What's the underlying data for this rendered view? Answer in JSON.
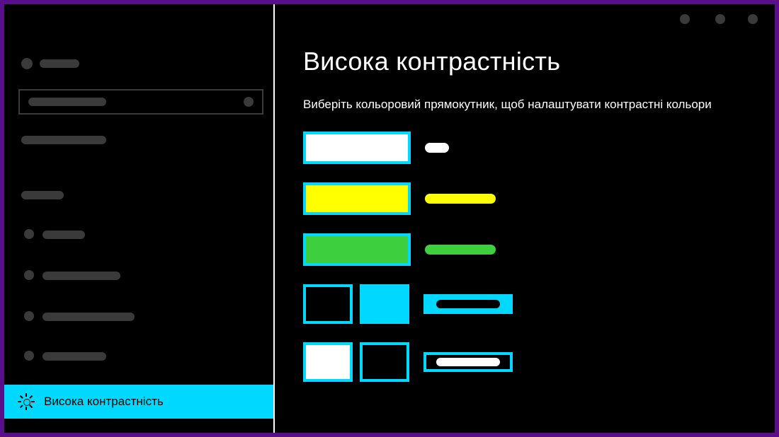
{
  "sidebar": {
    "active_item_label": "Висока контрастність"
  },
  "main": {
    "title": "Висока контрастність",
    "subtitle": "Виберіть кольоровий прямокутник, щоб налаштувати контрастні кольори",
    "swatches": [
      {
        "fill": "#ffffff",
        "border": "#00d8ff",
        "label_color": "#ffffff"
      },
      {
        "fill": "#ffff00",
        "border": "#00d8ff",
        "label_color": "#ffff00"
      },
      {
        "fill": "#3ecf3e",
        "border": "#00d8ff",
        "label_color": "#3ecf3e"
      }
    ],
    "button_pairs": [
      {
        "left_fill": "#000000",
        "right_fill": "#00d8ff",
        "chip_bg": "#00d8ff",
        "chip_inner": "#000000"
      },
      {
        "left_fill": "#ffffff",
        "right_fill": "#000000",
        "chip_bg": "#000000",
        "chip_inner": "#ffffff"
      }
    ]
  },
  "colors": {
    "accent": "#00d8ff",
    "frame": "#5a0f8a"
  }
}
